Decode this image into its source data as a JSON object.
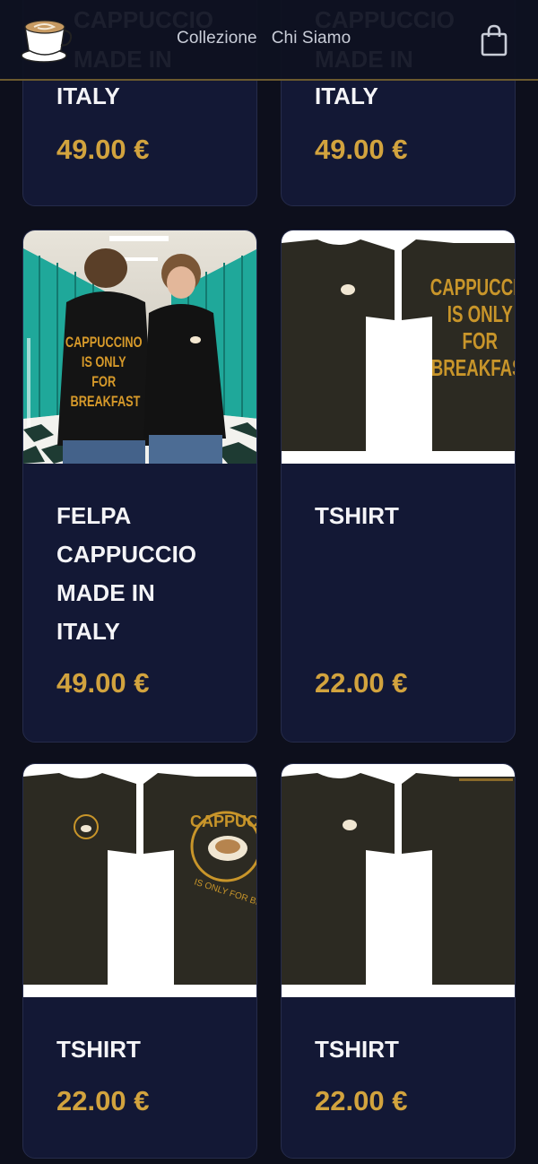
{
  "header": {
    "nav": [
      "Collezione",
      "Chi Siamo"
    ],
    "logo_icon": "coffee-cup-logo-icon",
    "cart_icon": "shopping-bag-icon"
  },
  "products": [
    {
      "title": "ITALY",
      "price": "49.00 €",
      "ghost": "CAPPUCCIO\nMADE IN"
    },
    {
      "title": "ITALY",
      "price": "49.00 €",
      "ghost": "CAPPUCCIO\nMADE IN"
    },
    {
      "title": "FELPA\nCAPPUCCIO\nMADE IN\nITALY",
      "price": "49.00 €",
      "image_text": "CAPPUCCINO\nIS ONLY\nFOR\nBREAKFAST"
    },
    {
      "title": "TSHIRT",
      "price": "22.00 €",
      "image_text": "CAPPUCCINO\nIS ONLY\nFOR\nBREAKFAST"
    },
    {
      "title": "TSHIRT",
      "price": "22.00 €",
      "image_text": "CAPPUCCINO\nIS ONLY FOR BREAKFAST"
    },
    {
      "title": "TSHIRT",
      "price": "22.00 €"
    }
  ],
  "colors": {
    "accent": "#d2a33e",
    "card_bg": "#131835",
    "page_bg": "#0d0f1c"
  }
}
